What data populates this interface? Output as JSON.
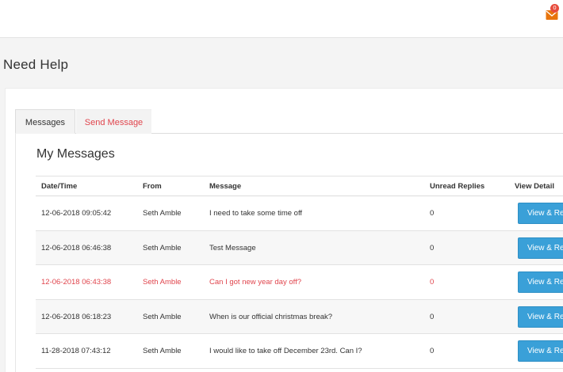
{
  "header": {
    "notification_count": "0",
    "icon": "envelope-icon",
    "icon_color": "#e8740c",
    "badge_color": "#e74c3c"
  },
  "page": {
    "title": "Need Help"
  },
  "tabs": [
    {
      "label": "Messages",
      "active": true
    },
    {
      "label": "Send Message",
      "active": false
    }
  ],
  "messages_section": {
    "title": "My Messages",
    "columns": [
      "Date/Time",
      "From",
      "Message",
      "Unread Replies",
      "View Detail"
    ],
    "button_label": "View & Reply",
    "rows": [
      {
        "datetime": "12-06-2018 09:05:42",
        "from": "Seth Amble",
        "message": "I need to take some time off",
        "unread": "0",
        "highlighted": false
      },
      {
        "datetime": "12-06-2018 06:46:38",
        "from": "Seth Amble",
        "message": "Test Message",
        "unread": "0",
        "highlighted": false
      },
      {
        "datetime": "12-06-2018 06:43:38",
        "from": "Seth Amble",
        "message": "Can I got new year day off?",
        "unread": "0",
        "highlighted": true
      },
      {
        "datetime": "12-06-2018 06:18:23",
        "from": "Seth Amble",
        "message": "When is our official christmas break?",
        "unread": "0",
        "highlighted": false
      },
      {
        "datetime": "11-28-2018 07:43:12",
        "from": "Seth Amble",
        "message": "I would like to take off December 23rd. Can I?",
        "unread": "0",
        "highlighted": false
      }
    ]
  },
  "colors": {
    "accent_red": "#e0454d",
    "button_blue": "#3aa0d8"
  }
}
